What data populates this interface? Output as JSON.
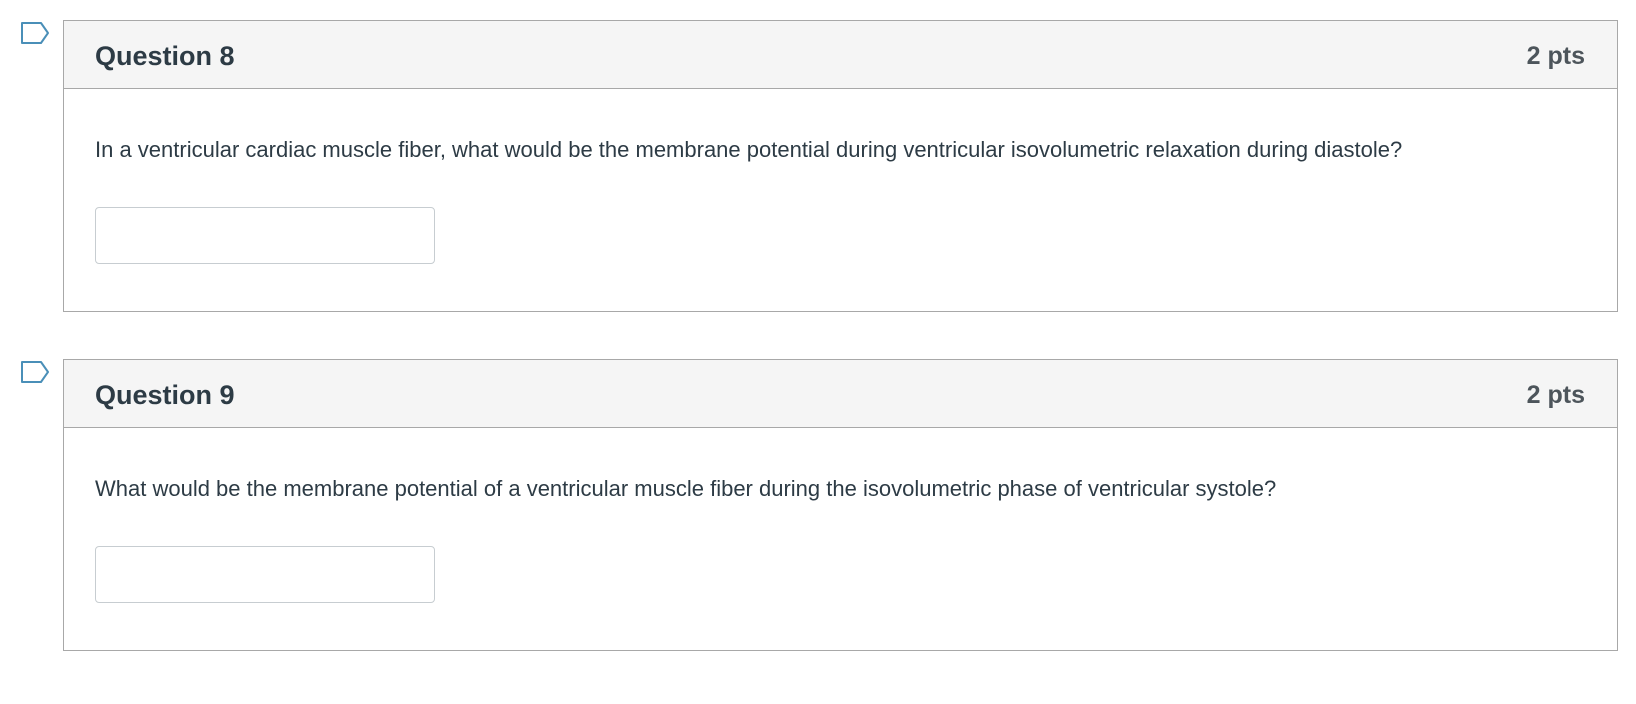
{
  "questions": [
    {
      "title": "Question 8",
      "points": "2 pts",
      "text": "In a ventricular cardiac muscle fiber, what would be the membrane potential during ventricular isovolumetric relaxation during diastole?",
      "answer_value": "",
      "flag_icon": "flag-outline-icon"
    },
    {
      "title": "Question 9",
      "points": "2 pts",
      "text": "What would be the membrane potential of a ventricular muscle fiber during the isovolumetric phase of ventricular systole?",
      "answer_value": "",
      "flag_icon": "flag-outline-icon"
    }
  ],
  "colors": {
    "text": "#2d3b45",
    "points": "#4d555b",
    "header_bg": "#f5f5f5",
    "border": "#a8a8a8",
    "flag_stroke": "#4a8fb8"
  }
}
